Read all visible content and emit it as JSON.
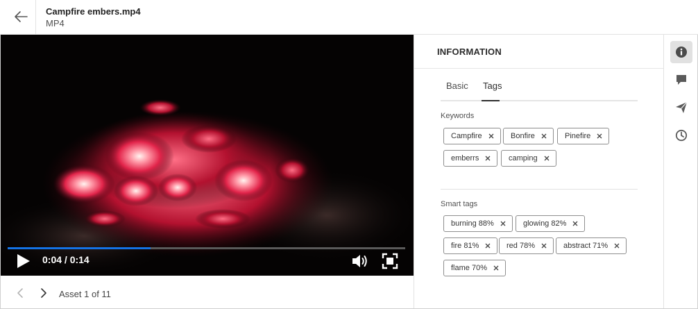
{
  "header": {
    "title": "Campfire embers.mp4",
    "subtitle": "MP4",
    "back_icon": "arrow-left-icon"
  },
  "player": {
    "time": "0:04 / 0:14",
    "progress": 0.36,
    "accent": "#1473e6",
    "icons": [
      "play-icon",
      "volume-icon",
      "fullscreen-icon"
    ]
  },
  "pager": {
    "label": "Asset 1 of 11"
  },
  "panel": {
    "title": "INFORMATION",
    "tabs": [
      "Basic",
      "Tags"
    ],
    "active_tab": "Tags",
    "keywords_label": "Keywords",
    "keywords": [
      "Campfire",
      "Bonfire",
      "Pinefire",
      "emberrs",
      "camping"
    ],
    "smart_tags_label": "Smart tags",
    "smart_tags": [
      "burning 88%",
      "glowing 82%",
      "fire 81%",
      "red 78%",
      "abstract 71%",
      "flame 70%"
    ]
  },
  "rail": {
    "items": [
      "info-icon",
      "comment-icon",
      "send-icon",
      "history-icon"
    ],
    "active": "info-icon"
  }
}
